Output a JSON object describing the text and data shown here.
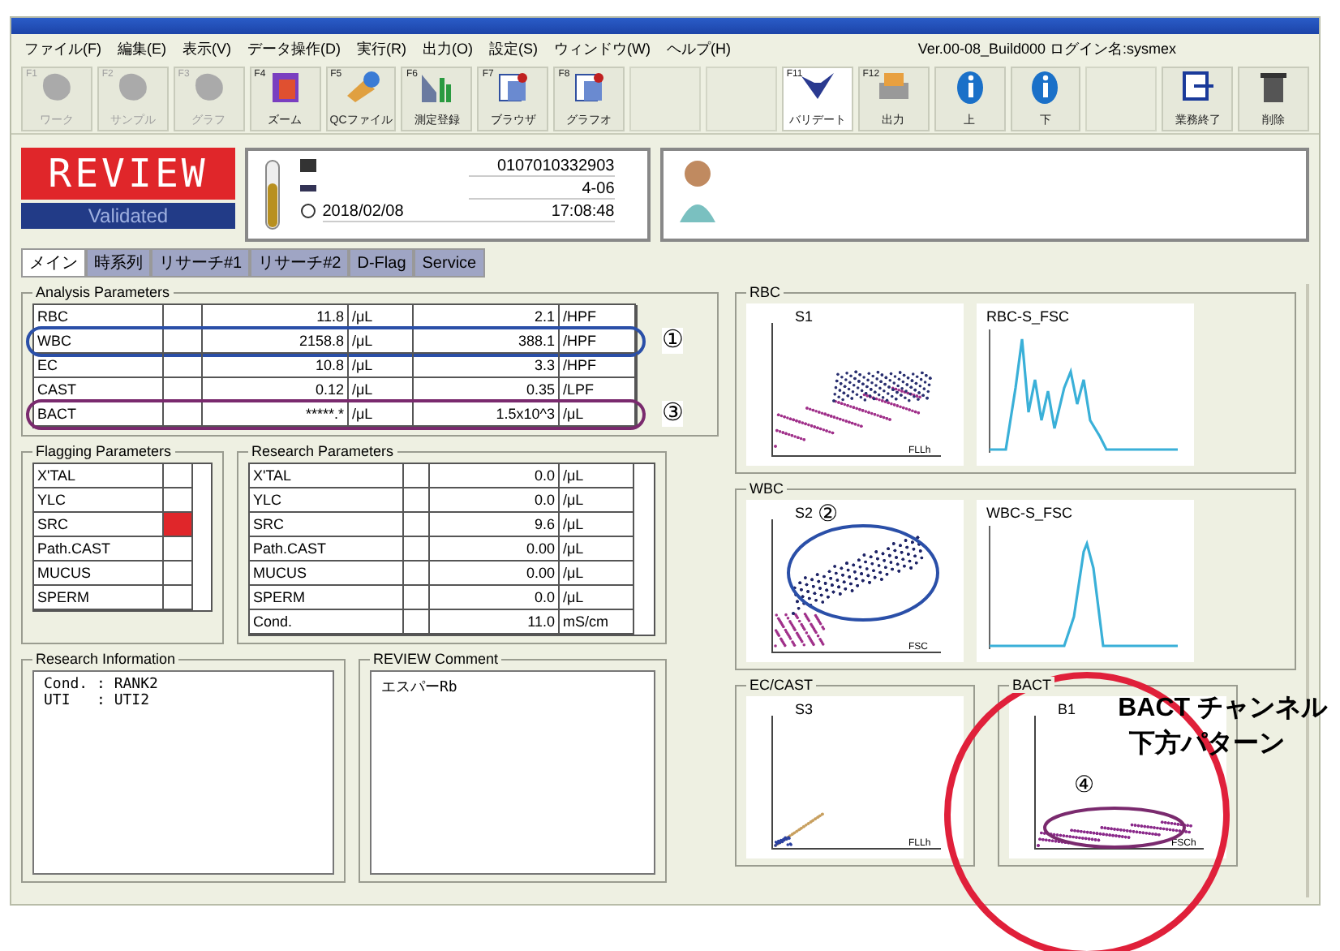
{
  "menu": [
    "ファイル(F)",
    "編集(E)",
    "表示(V)",
    "データ操作(D)",
    "実行(R)",
    "出力(O)",
    "設定(S)",
    "ウィンドウ(W)",
    "ヘルプ(H)"
  ],
  "version": "Ver.00-08_Build000 ログイン名:sysmex",
  "toolbar": [
    {
      "key": "F1",
      "label": "ワーク",
      "disabled": true,
      "kind": "blob"
    },
    {
      "key": "F2",
      "label": "サンプル",
      "disabled": true,
      "kind": "blob"
    },
    {
      "key": "F3",
      "label": "グラフ",
      "disabled": true,
      "kind": "blob"
    },
    {
      "key": "F4",
      "label": "ズーム",
      "disabled": false,
      "kind": "book"
    },
    {
      "key": "F5",
      "label": "QCファイル",
      "disabled": false,
      "kind": "globe"
    },
    {
      "key": "F6",
      "label": "測定登録",
      "disabled": false,
      "kind": "chart"
    },
    {
      "key": "F7",
      "label": "ブラウザ",
      "disabled": false,
      "kind": "doc"
    },
    {
      "key": "F8",
      "label": "グラフオ",
      "disabled": false,
      "kind": "doc"
    },
    {
      "kind": "gap"
    },
    {
      "kind": "gap"
    },
    {
      "key": "F11",
      "label": "バリデート",
      "disabled": false,
      "kind": "check",
      "selected": true
    },
    {
      "key": "F12",
      "label": "出力",
      "disabled": false,
      "kind": "print"
    },
    {
      "label": "上",
      "disabled": false,
      "kind": "info"
    },
    {
      "label": "下",
      "disabled": false,
      "kind": "info"
    },
    {
      "kind": "gap"
    },
    {
      "label": "業務終了",
      "disabled": false,
      "kind": "logout"
    },
    {
      "label": "削除",
      "disabled": false,
      "kind": "trash"
    }
  ],
  "status": {
    "review": "REVIEW",
    "validated": "Validated"
  },
  "sample": {
    "number": "0107010332903",
    "rack": "4-06",
    "date": "2018/02/08",
    "time": "17:08:48"
  },
  "tabs": [
    {
      "label": "メイン",
      "selected": true
    },
    {
      "label": "時系列",
      "selected": false
    },
    {
      "label": "リサーチ#1",
      "selected": false
    },
    {
      "label": "リサーチ#2",
      "selected": false
    },
    {
      "label": "D-Flag",
      "selected": false
    },
    {
      "label": "Service",
      "selected": false
    }
  ],
  "analysis": {
    "title": "Analysis Parameters",
    "rows": [
      {
        "name": "RBC",
        "count": "11.8",
        "unit": "/μL",
        "hpf": "2.1",
        "hpf_unit": "/HPF"
      },
      {
        "name": "WBC",
        "count": "2158.8",
        "unit": "/μL",
        "hpf": "388.1",
        "hpf_unit": "/HPF",
        "annotation": "①",
        "color": "#2a4fa8"
      },
      {
        "name": "EC",
        "count": "10.8",
        "unit": "/μL",
        "hpf": "3.3",
        "hpf_unit": "/HPF"
      },
      {
        "name": "CAST",
        "count": "0.12",
        "unit": "/μL",
        "hpf": "0.35",
        "hpf_unit": "/LPF"
      },
      {
        "name": "BACT",
        "count": "*****.*",
        "unit": "/μL",
        "hpf": "1.5x10^3",
        "hpf_unit": "/μL",
        "annotation": "③",
        "color": "#7a2a6e"
      }
    ]
  },
  "flagging": {
    "title": "Flagging Parameters",
    "rows": [
      {
        "name": "X'TAL",
        "flagged": false
      },
      {
        "name": "YLC",
        "flagged": false
      },
      {
        "name": "SRC",
        "flagged": true
      },
      {
        "name": "Path.CAST",
        "flagged": false
      },
      {
        "name": "MUCUS",
        "flagged": false
      },
      {
        "name": "SPERM",
        "flagged": false
      }
    ]
  },
  "research": {
    "title": "Research Parameters",
    "rows": [
      {
        "name": "X'TAL",
        "value": "0.0",
        "unit": "/μL"
      },
      {
        "name": "YLC",
        "value": "0.0",
        "unit": "/μL"
      },
      {
        "name": "SRC",
        "value": "9.6",
        "unit": "/μL"
      },
      {
        "name": "Path.CAST",
        "value": "0.00",
        "unit": "/μL"
      },
      {
        "name": "MUCUS",
        "value": "0.00",
        "unit": "/μL"
      },
      {
        "name": "SPERM",
        "value": "0.0",
        "unit": "/μL"
      },
      {
        "name": "Cond.",
        "value": "11.0",
        "unit": "mS/cm"
      }
    ]
  },
  "research_info": {
    "title": "Research Information",
    "lines": [
      "Cond. : RANK2",
      "UTI   : UTI2"
    ]
  },
  "comment": {
    "title": "REVIEW Comment",
    "text": "エスパーRb"
  },
  "panels": [
    {
      "title": "RBC",
      "plots": [
        {
          "kind": "scatter",
          "label": "S1",
          "axis": "FLLh"
        },
        {
          "kind": "histogram",
          "label": "RBC-S_FSC"
        }
      ]
    },
    {
      "title": "WBC",
      "plots": [
        {
          "kind": "scatter",
          "label": "S2",
          "axis": "FSC",
          "annotation": "②",
          "color": "#2a4fa8"
        },
        {
          "kind": "histogram",
          "label": "WBC-S_FSC"
        }
      ]
    },
    {
      "title": "EC/CAST",
      "plots": [
        {
          "kind": "scatter",
          "label": "S3",
          "axis": "FLLh"
        }
      ]
    },
    {
      "title": "BACT",
      "plots": [
        {
          "kind": "scatter",
          "label": "B1",
          "axis": "FSCh",
          "annotation": "④",
          "color": "#7a2a6e"
        }
      ]
    }
  ],
  "callout": {
    "lines": [
      "BACT チャンネル",
      "下方パターン"
    ],
    "color": "#e0203a"
  }
}
